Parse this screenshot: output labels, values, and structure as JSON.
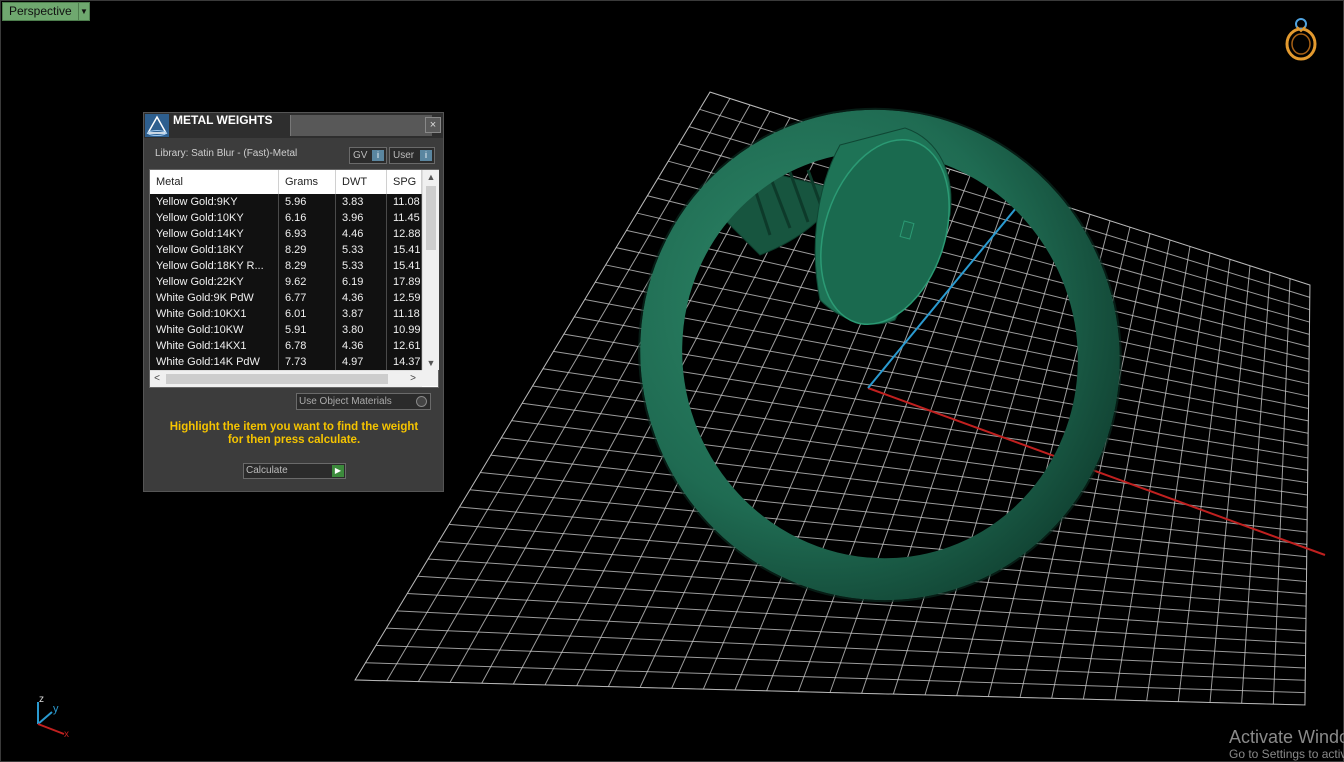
{
  "viewport": {
    "label": "Perspective",
    "background": "#000000",
    "grid_color": "#cfcfcf",
    "model_color": "#1f6b52",
    "axis_x_color": "#c0201f",
    "axis_y_color": "#2a9ad0"
  },
  "panel": {
    "title": "METAL WEIGHTS",
    "close_glyph": "×",
    "library_label": "Library: Satin Blur - (Fast)-Metal",
    "gv_label": "GV",
    "user_label": "User",
    "table": {
      "columns": [
        "Metal",
        "Grams",
        "DWT",
        "SPG"
      ],
      "rows": [
        [
          "Yellow Gold:9KY",
          "5.96",
          "3.83",
          "11.08"
        ],
        [
          "Yellow Gold:10KY",
          "6.16",
          "3.96",
          "11.45"
        ],
        [
          "Yellow Gold:14KY",
          "6.93",
          "4.46",
          "12.88"
        ],
        [
          "Yellow Gold:18KY",
          "8.29",
          "5.33",
          "15.41"
        ],
        [
          "Yellow Gold:18KY R...",
          "8.29",
          "5.33",
          "15.41"
        ],
        [
          "Yellow Gold:22KY",
          "9.62",
          "6.19",
          "17.89"
        ],
        [
          "White Gold:9K PdW",
          "6.77",
          "4.36",
          "12.59"
        ],
        [
          "White Gold:10KX1",
          "6.01",
          "3.87",
          "11.18"
        ],
        [
          "White Gold:10KW",
          "5.91",
          "3.80",
          "10.99"
        ],
        [
          "White Gold:14KX1",
          "6.78",
          "4.36",
          "12.61"
        ],
        [
          "White Gold:14K PdW",
          "7.73",
          "4.97",
          "14.37"
        ]
      ]
    },
    "use_object_materials_label": "Use Object Materials",
    "help_text_line1": "Highlight the item you want to find the weight",
    "help_text_line2": "for then press calculate.",
    "calculate_label": "Calculate",
    "help_color": "#f5c400"
  },
  "axis_gizmo": {
    "z": "z",
    "y": "y",
    "x": "x"
  },
  "watermark": {
    "line1": "Activate Windows",
    "line2": "Go to Settings to activate Windows."
  },
  "icons": {
    "ring": "ring-icon",
    "logo": "rhino-pyramid-icon",
    "dropdown": "chevron-down-icon",
    "close": "close-icon",
    "scroll_up": "chevron-up-icon",
    "scroll_down": "chevron-down-icon",
    "scroll_left": "chevron-left-icon",
    "scroll_right": "chevron-right-icon",
    "go": "play-icon"
  }
}
